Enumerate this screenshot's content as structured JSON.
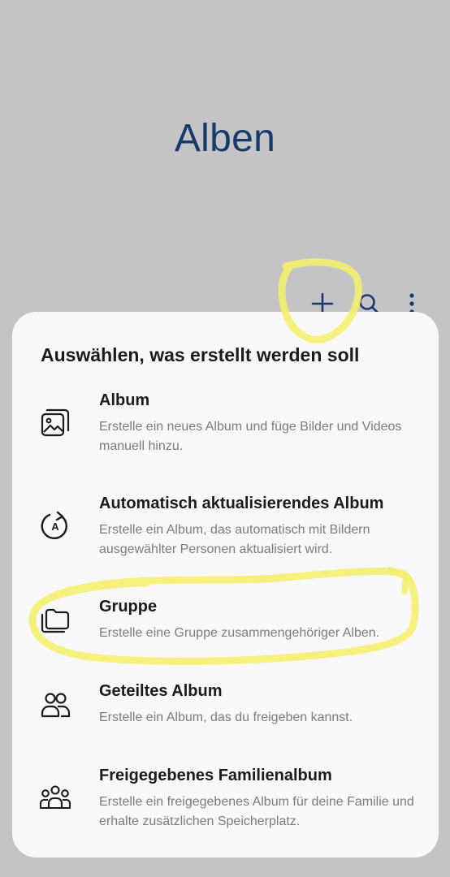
{
  "header": {
    "title": "Alben"
  },
  "toolbar": {
    "icons": [
      "plus-icon",
      "search-icon",
      "more-vert-icon"
    ]
  },
  "sheet": {
    "title": "Auswählen, was erstellt werden soll",
    "options": [
      {
        "icon": "album-icon",
        "label": "Album",
        "description": "Erstelle ein neues Album und füge Bilder und Videos manuell hinzu."
      },
      {
        "icon": "auto-update-icon",
        "label": "Automatisch aktualisierendes Album",
        "description": "Erstelle ein Album, das automatisch mit Bildern ausgewählter Personen aktualisiert wird."
      },
      {
        "icon": "folder-icon",
        "label": "Gruppe",
        "description": "Erstelle eine Gruppe zusammengehöriger Alben."
      },
      {
        "icon": "shared-people-icon",
        "label": "Geteiltes Album",
        "description": "Erstelle ein Album, das du freigeben kannst."
      },
      {
        "icon": "family-icon",
        "label": "Freigegebenes Familienalbum",
        "description": "Erstelle ein freigegebenes Album für deine Familie und erhalte zusätzlichen Speicherplatz."
      }
    ]
  },
  "colors": {
    "background": "#c4c3c6",
    "title": "#173a6b",
    "sheet": "#f8f8fa",
    "highlight": "#f4f06e"
  }
}
